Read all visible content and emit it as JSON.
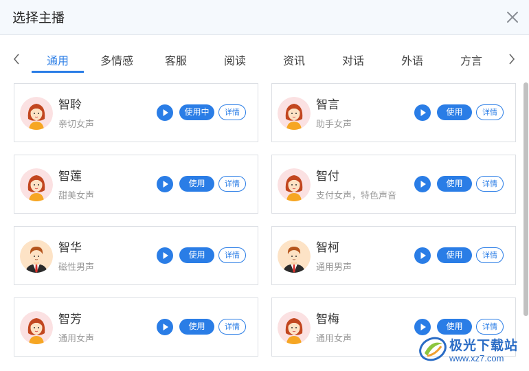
{
  "dialog": {
    "title": "选择主播"
  },
  "tabs": [
    {
      "label": "通用",
      "active": true
    },
    {
      "label": "多情感",
      "active": false
    },
    {
      "label": "客服",
      "active": false
    },
    {
      "label": "阅读",
      "active": false
    },
    {
      "label": "资讯",
      "active": false
    },
    {
      "label": "对话",
      "active": false
    },
    {
      "label": "外语",
      "active": false
    },
    {
      "label": "方言",
      "active": false
    }
  ],
  "voices": [
    {
      "name": "智聆",
      "desc": "亲切女声",
      "button": "使用中",
      "detail": "详情",
      "gender": "female"
    },
    {
      "name": "智言",
      "desc": "助手女声",
      "button": "使用",
      "detail": "详情",
      "gender": "female"
    },
    {
      "name": "智莲",
      "desc": "甜美女声",
      "button": "使用",
      "detail": "详情",
      "gender": "female"
    },
    {
      "name": "智付",
      "desc": "支付女声，特色声音",
      "button": "使用",
      "detail": "详情",
      "gender": "female"
    },
    {
      "name": "智华",
      "desc": "磁性男声",
      "button": "使用",
      "detail": "详情",
      "gender": "male"
    },
    {
      "name": "智柯",
      "desc": "通用男声",
      "button": "使用",
      "detail": "详情",
      "gender": "male"
    },
    {
      "name": "智芳",
      "desc": "通用女声",
      "button": "使用",
      "detail": "详情",
      "gender": "female"
    },
    {
      "name": "智梅",
      "desc": "通用女声",
      "button": "使用",
      "detail": "详情",
      "gender": "female"
    }
  ],
  "watermark": {
    "name": "极光下载站",
    "url": "www.xz7.com"
  },
  "colors": {
    "accent": "#2a7de6",
    "header_bg": "#f5f9fd"
  }
}
